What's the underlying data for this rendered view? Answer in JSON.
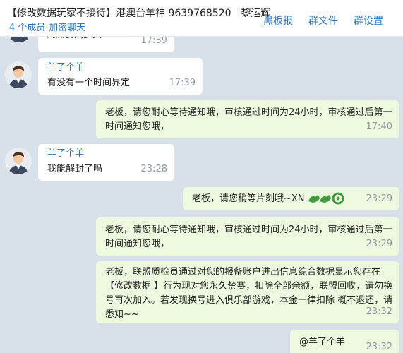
{
  "header": {
    "group_name": "【修改数据玩家不接待】港澳台羊神 9639768520",
    "owner_name": "黎运辉",
    "member_status": "4 个成员-加密聊天",
    "actions": [
      "黑板报",
      "群文件",
      "群设置"
    ]
  },
  "messages": [
    {
      "direction": "in",
      "sender": "",
      "text": "到底要搞多久",
      "time": "17:39"
    },
    {
      "direction": "in",
      "sender": "羊了个羊",
      "text": "有没有一个时间界定",
      "time": "17:39"
    },
    {
      "direction": "out",
      "sender": "",
      "text": "老板，请您耐心等待通知哦，审核通过时间为24小时，审核通过后第一时间通知您哦，",
      "time": "17:40"
    },
    {
      "direction": "in",
      "sender": "羊了个羊",
      "text": "我能解封了吗",
      "time": "23:28"
    },
    {
      "direction": "out",
      "sender": "",
      "text": "老板，请您稍等片刻哦~XN",
      "time": "23:29"
    },
    {
      "direction": "out",
      "sender": "",
      "text": "老板，请您耐心等待通知哦，审核通过时间为24小时，审核通过后第一时间通知您哦，",
      "time": "23:29"
    },
    {
      "direction": "out",
      "sender": "",
      "text": "老板，联盟质检员通过对您的报备账户进出信息综合数据显示您存在【修改数据 】行为现对您永久禁赛，扣除全部余额，联盟回收，请勿换号再次加入。若发现换号进入俱乐部游戏，本金一律扣除 概不退还，请悉知~~",
      "time": "23:32"
    },
    {
      "direction": "out",
      "sender": "",
      "text": "@羊了个羊",
      "time": "23:32"
    }
  ],
  "colors": {
    "chat_bg": "#d8e1ea",
    "out_bubble": "#eefadf",
    "link": "#2b74c7"
  },
  "emoji_icons": [
    "dragon-icon",
    "dragon-icon",
    "dragon-icon"
  ]
}
